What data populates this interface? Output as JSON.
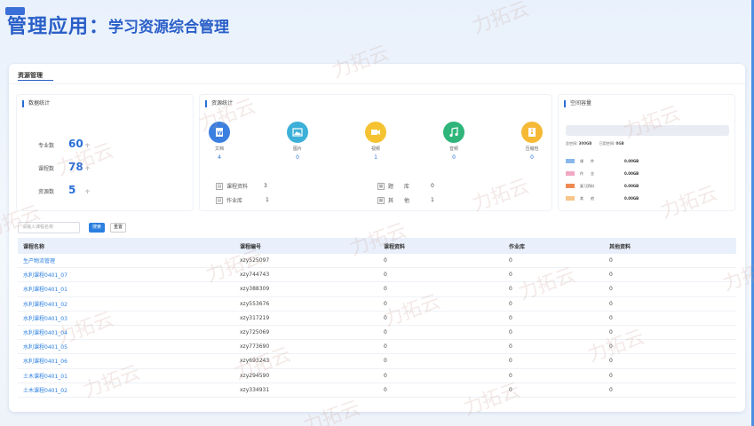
{
  "header": {
    "title": "管理应用：",
    "subtitle": "学习资源综合管理"
  },
  "panel": {
    "title": "资源管理"
  },
  "data_stats": {
    "title": "数据统计",
    "rows": [
      {
        "label": "专业数",
        "value": "60",
        "unit": "个"
      },
      {
        "label": "课程数",
        "value": "78",
        "unit": "个"
      },
      {
        "label": "资源数",
        "value": "5",
        "unit": "个"
      }
    ]
  },
  "resource_stats": {
    "title": "资源统计",
    "items": [
      {
        "label": "文档",
        "count": "4",
        "color": "#3b7fe0",
        "icon": "word-icon"
      },
      {
        "label": "图片",
        "count": "0",
        "color": "#3cb0d8",
        "icon": "image-icon"
      },
      {
        "label": "视频",
        "count": "1",
        "color": "#f5c332",
        "icon": "video-icon"
      },
      {
        "label": "音频",
        "count": "0",
        "color": "#2fb57a",
        "icon": "music-icon"
      },
      {
        "label": "压缩包",
        "count": "0",
        "color": "#f5b935",
        "icon": "archive-icon"
      }
    ],
    "sub": [
      {
        "label": "课程资料",
        "value": "3"
      },
      {
        "label": "作业库",
        "value": "1"
      },
      {
        "label": "题　　库",
        "value": "0"
      },
      {
        "label": "其　　他",
        "value": "1"
      }
    ]
  },
  "space": {
    "title": "空间容量",
    "total_label": "总空间:",
    "total": "300GB",
    "used_label": "已用空间:",
    "used": "0GB",
    "legend": [
      {
        "name": "课　　件",
        "value": "0.00GB",
        "color": "#8ab8ec"
      },
      {
        "name": "作　　业",
        "value": "0.00GB",
        "color": "#f2a9c3"
      },
      {
        "name": "复习资料",
        "value": "0.00GB",
        "color": "#ef8a52"
      },
      {
        "name": "其　　他",
        "value": "0.00GB",
        "color": "#f7c58a"
      }
    ]
  },
  "search": {
    "placeholder": "请输入课程名称",
    "search_label": "搜索",
    "reset_label": "重置"
  },
  "table": {
    "headers": [
      "课程名称",
      "课程编号",
      "课程资料",
      "作业库",
      "其他资料"
    ],
    "rows": [
      [
        "生产物流管理",
        "xzy525097",
        "0",
        "0",
        "0"
      ],
      [
        "水利课程0401_07",
        "xzy744743",
        "0",
        "0",
        "0"
      ],
      [
        "水利课程0401_01",
        "xzy388309",
        "0",
        "0",
        "0"
      ],
      [
        "水利课程0401_02",
        "xzy553676",
        "0",
        "0",
        "0"
      ],
      [
        "水利课程0401_03",
        "xzy317219",
        "0",
        "0",
        "0"
      ],
      [
        "水利课程0401_04",
        "xzy725069",
        "0",
        "0",
        "0"
      ],
      [
        "水利课程0401_05",
        "xzy773690",
        "0",
        "0",
        "0"
      ],
      [
        "水利课程0401_06",
        "xzy693243",
        "0",
        "0",
        "0"
      ],
      [
        "土木课程0401_01",
        "xzy294590",
        "0",
        "0",
        "0"
      ],
      [
        "土木课程0401_02",
        "xzy334931",
        "0",
        "0",
        "0"
      ]
    ]
  },
  "watermark": "力拓云"
}
